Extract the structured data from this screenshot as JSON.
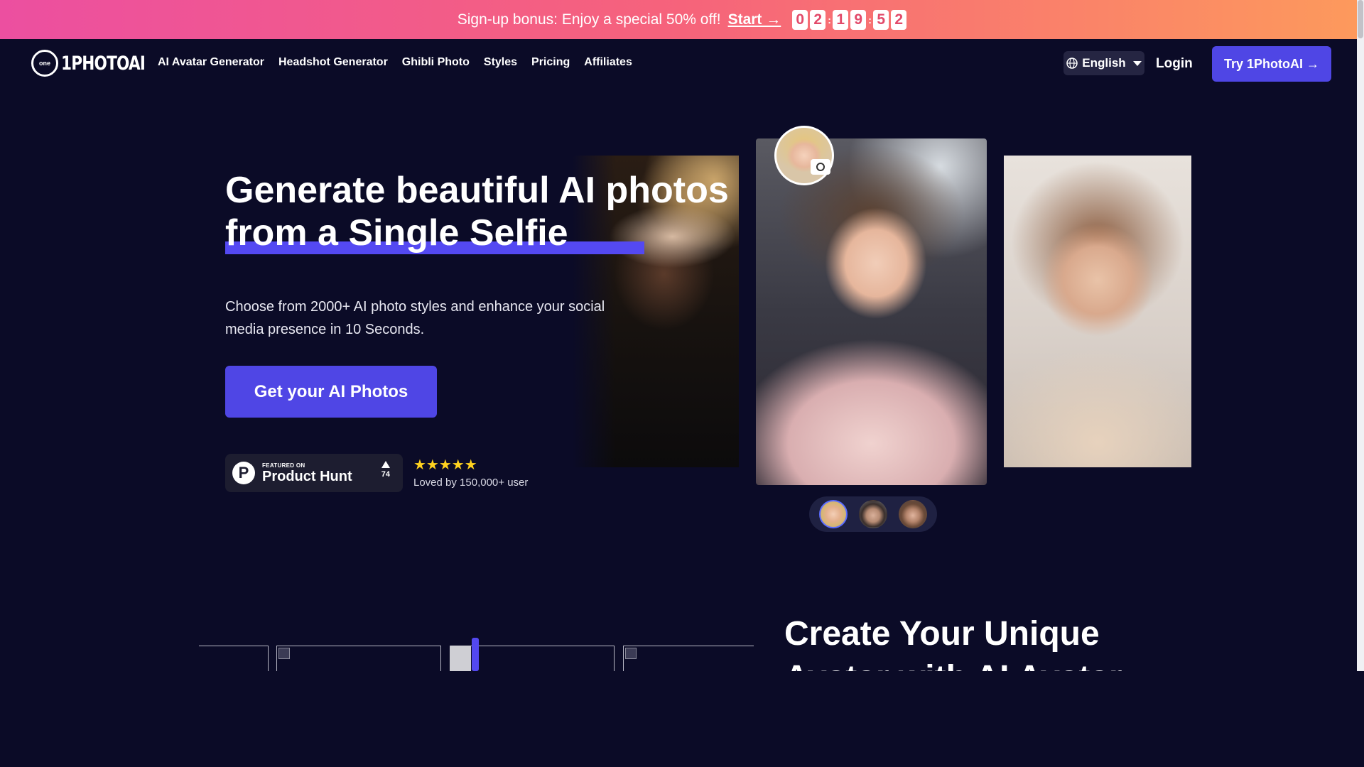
{
  "promo": {
    "text": "Sign-up bonus: Enjoy a special 50% off!",
    "start_label": "Start →",
    "countdown": [
      "0",
      "2",
      "1",
      "9",
      "5",
      "2"
    ]
  },
  "nav": {
    "logo_badge": "one",
    "logo_text": "1PHOTOAI",
    "links": [
      "AI Avatar Generator",
      "Headshot Generator",
      "Ghibli Photo",
      "Styles",
      "Pricing",
      "Affiliates"
    ],
    "language": "English",
    "login": "Login",
    "try_button": "Try 1PhotoAI →"
  },
  "hero": {
    "title_line1": "Generate beautiful AI photos",
    "title_line2": "from a Single Selfie",
    "subtitle": "Choose from 2000+ AI photo styles and enhance your social media presence in 10 Seconds.",
    "cta": "Get your AI Photos",
    "product_hunt": {
      "featured": "FEATURED ON",
      "name": "Product Hunt",
      "logo_letter": "P",
      "votes": "74"
    },
    "stars": "★★★★★",
    "rating_text": "Loved by 150,000+ user"
  },
  "section2": {
    "title": "Create Your Unique Avatar with AI Avatar"
  },
  "colors": {
    "accent": "#4f46e5",
    "background": "#0b0b27",
    "promo_gradient_start": "#ec4fa0",
    "promo_gradient_end": "#fd9a5c",
    "star": "#ffd21f"
  },
  "icons": [
    "globe-icon",
    "chevron-down-icon",
    "camera-icon",
    "product-hunt-icon",
    "upvote-icon",
    "broken-image-icon"
  ]
}
